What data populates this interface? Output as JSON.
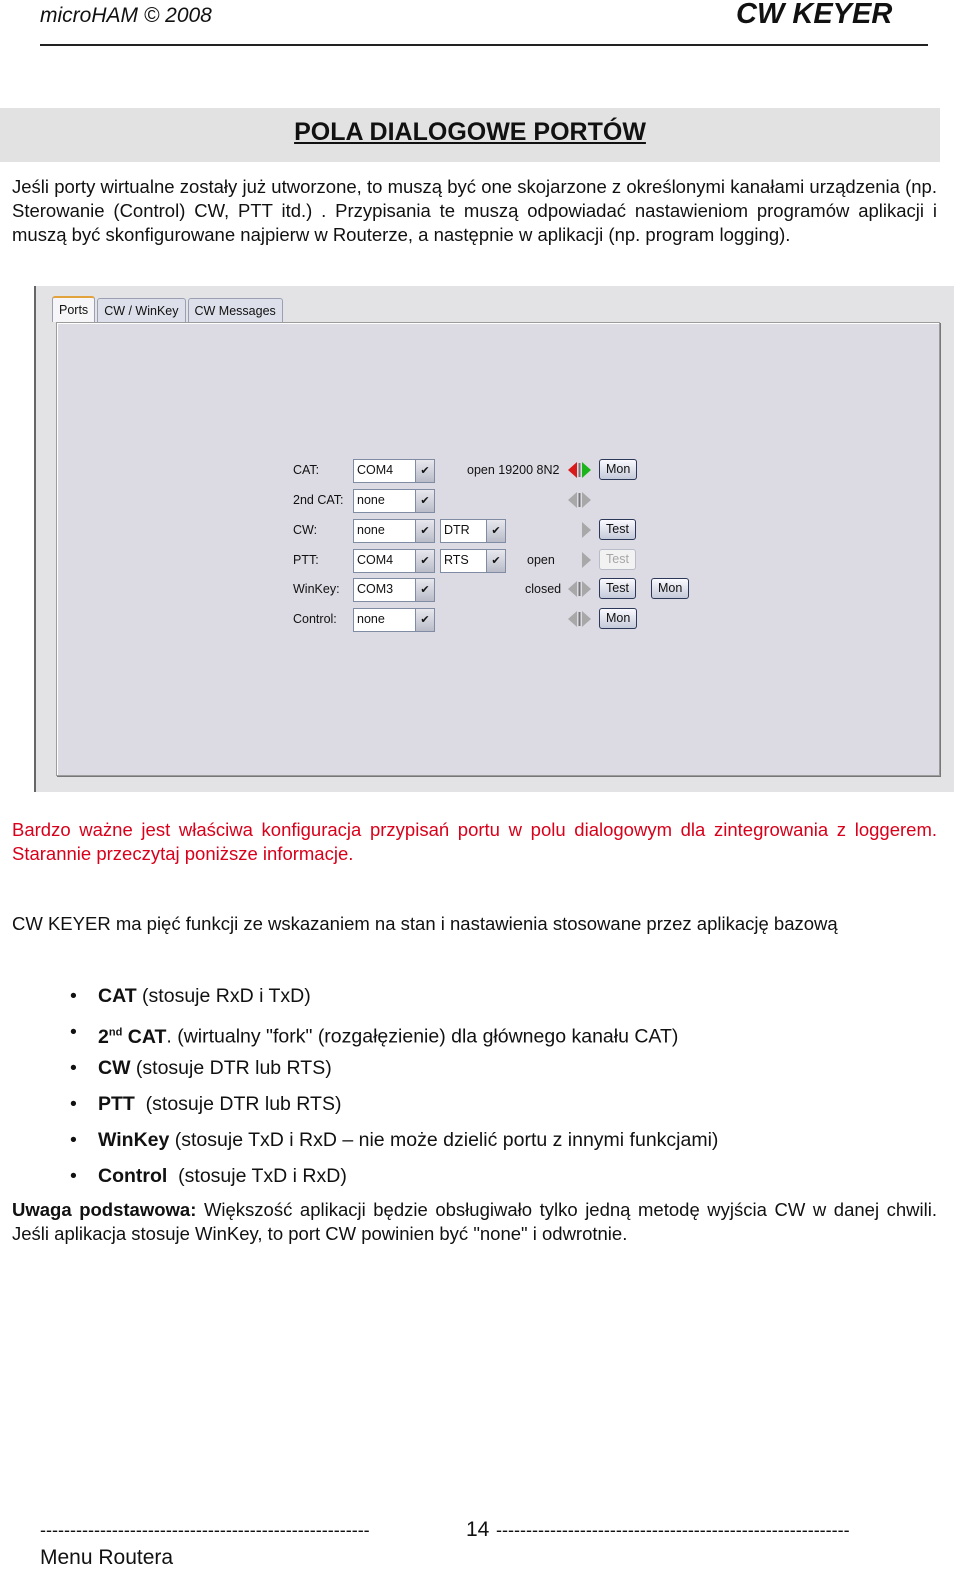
{
  "header": {
    "left": "microHAM © 2008",
    "right": "CW KEYER"
  },
  "title": "POLA DIALOGOWE PORTÓW",
  "intro": "Jeśli porty wirtualne zostały już utworzone, to muszą być one skojarzone z określonymi kanałami urządzenia (np. Sterowanie (Control) CW, PTT itd.) . Przypisania te muszą odpowiadać nastawieniom programów aplikacji i muszą być skonfigurowane najpierw w Routerze, a następnie w aplikacji (np. program logging).",
  "dialog": {
    "tabs": [
      "Ports",
      "CW / WinKey",
      "CW Messages"
    ],
    "active_tab": "Ports",
    "rows": [
      {
        "label": "CAT:",
        "port": "COM4",
        "line": null,
        "status": "open 19200 8N2",
        "led": "active",
        "buttons": [
          "Mon"
        ]
      },
      {
        "label": "2nd CAT:",
        "port": "none",
        "line": null,
        "status": "",
        "led": "idle",
        "buttons": []
      },
      {
        "label": "CW:",
        "port": "none",
        "line": "DTR",
        "status": "",
        "led": "right-only",
        "buttons": [
          "Test"
        ]
      },
      {
        "label": "PTT:",
        "port": "COM4",
        "line": "RTS",
        "status": "open",
        "led": "right-only",
        "buttons": [
          "Test"
        ],
        "disabled": true
      },
      {
        "label": "WinKey:",
        "port": "COM3",
        "line": null,
        "status": "closed",
        "led": "idle",
        "buttons": [
          "Test",
          "Mon"
        ]
      },
      {
        "label": "Control:",
        "port": "none",
        "line": null,
        "status": "",
        "led": "idle",
        "buttons": [
          "Mon"
        ]
      }
    ],
    "colors": {
      "led_red": "#d81a1a",
      "led_green": "#1cb41c",
      "led_idle": "#a8a8a8"
    }
  },
  "warning": "Bardzo ważne jest właściwa konfiguracja przypisań portu w polu dialogowym dla zintegrowania z loggerem. Starannie przeczytaj poniższe informacje.",
  "functions_intro": "CW KEYER ma pięć funkcji ze wskazaniem na stan i nastawienia stosowane przez aplikację bazową",
  "functions": [
    {
      "name": "CAT",
      "sup": "",
      "desc": " (stosuje RxD i TxD)"
    },
    {
      "name": "2",
      "sup": "nd",
      "name2": " CAT",
      "desc": ". (wirtualny \"fork\" (rozgałęzienie) dla głównego kanału CAT)"
    },
    {
      "name": "CW",
      "sup": "",
      "desc": " (stosuje DTR lub RTS)"
    },
    {
      "name": "PTT",
      "sup": "",
      "desc": "  (stosuje DTR lub RTS)"
    },
    {
      "name": "WinKey",
      "sup": "",
      "desc": " (stosuje TxD i RxD – nie może dzielić portu z innymi funkcjami)"
    },
    {
      "name": "Control",
      "sup": "",
      "desc": "  (stosuje TxD i RxD)"
    }
  ],
  "note": {
    "label": "Uwaga podstawowa:",
    "text": " Większość aplikacji będzie obsługiwało tylko jedną metodę wyjścia CW w danej chwili. Jeśli aplikacja stosuje WinKey, to port CW powinien być \"none\" i odwrotnie."
  },
  "footer": {
    "page_number": "14",
    "section": "Menu Routera"
  }
}
